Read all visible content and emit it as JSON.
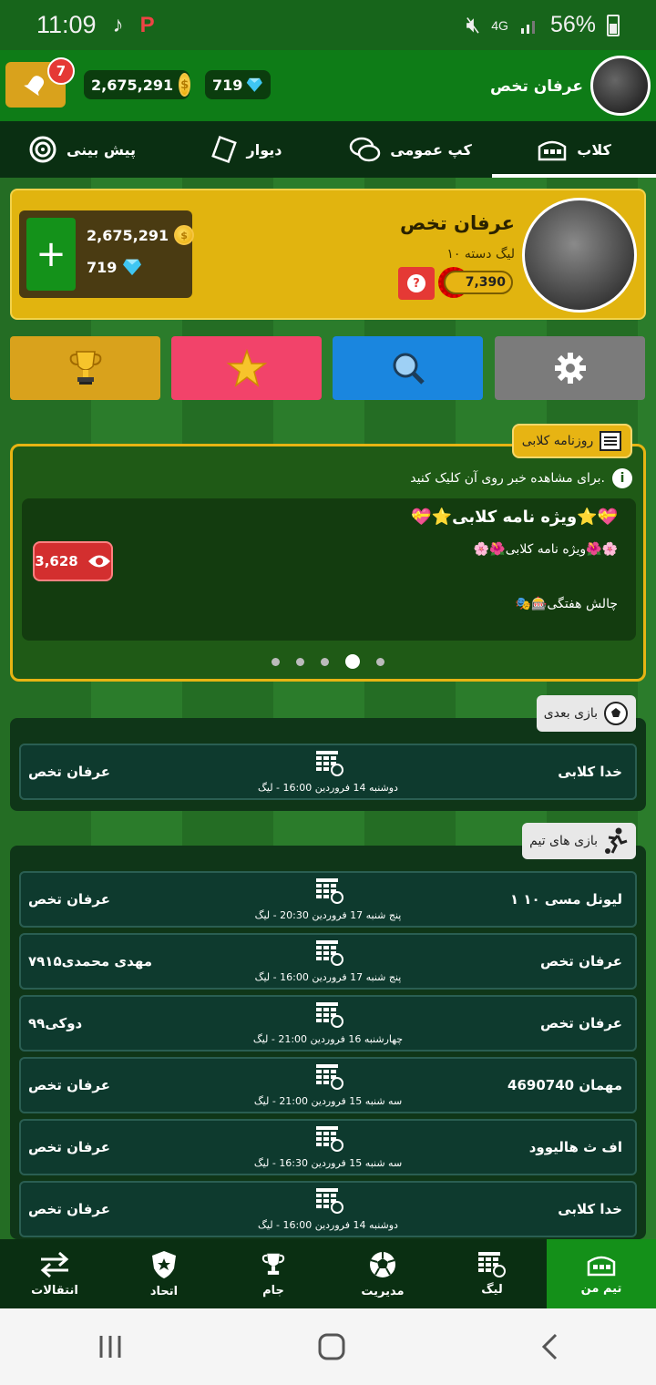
{
  "status_bar": {
    "time": "11:09",
    "battery": "56%",
    "network": "4G",
    "icons": [
      "music-note-icon",
      "app-notification-icon",
      "mute-icon",
      "signal-icon",
      "battery-icon"
    ]
  },
  "top_bar": {
    "notification_count": "7",
    "coins": "2,675,291",
    "gems": "719",
    "username": "عرفان تخص"
  },
  "tabs": [
    {
      "label": "کلاب",
      "icon": "stadium-icon",
      "active": true
    },
    {
      "label": "کپ عمومی",
      "icon": "chat-bubbles-icon",
      "active": false
    },
    {
      "label": "دیوار",
      "icon": "wall-card-icon",
      "active": false
    },
    {
      "label": "پیش بینی",
      "icon": "target-icon",
      "active": false
    }
  ],
  "profile": {
    "name": "عرفان تخص",
    "league": "لیگ دسته ۱۰",
    "xp": "7,390",
    "coins": "2,675,291",
    "gems": "719",
    "add_label": "+"
  },
  "actions": [
    {
      "name": "settings-button",
      "icon": "gear-icon",
      "color": "#7b7b7b"
    },
    {
      "name": "search-button",
      "icon": "search-icon",
      "color": "#1a86df"
    },
    {
      "name": "favorites-button",
      "icon": "star-icon",
      "color": "#f2436a"
    },
    {
      "name": "trophies-button",
      "icon": "trophy-icon",
      "color": "#d9a21c"
    }
  ],
  "news": {
    "tag": "روزنامه کلابی",
    "hint": "برای مشاهده خبر روی آن کلیک کنید.",
    "title": "💝⭐ویژه نامه کلابی⭐💝",
    "subtitle": "🌸🌺ویژه نامه کلابی🌺🌸",
    "subtitle2": "🎭🎰چالش هفتگی",
    "views": "3,628",
    "dots_count": 5,
    "active_dot": 3
  },
  "next_match": {
    "tag": "بازی بعدی",
    "match": {
      "home": "خدا کلابی",
      "away": "عرفان تخص",
      "info": "دوشنبه 14 فروردین 16:00 - لیگ"
    }
  },
  "team_matches": {
    "tag": "بازی های تیم",
    "matches": [
      {
        "home": "۱ لیونل مسی ۱۰",
        "away": "عرفان تخص",
        "info": "پنج شنبه 17 فروردین 20:30 - لیگ"
      },
      {
        "home": "عرفان تخص",
        "away": "مهدی محمدی۷۹۱۵",
        "info": "پنج شنبه 17 فروردین 16:00 - لیگ"
      },
      {
        "home": "عرفان تخص",
        "away": "دوکی۹۹",
        "info": "چهارشنبه 16 فروردین 21:00 - لیگ"
      },
      {
        "home": "مهمان 4690740",
        "away": "عرفان تخص",
        "info": "سه شنبه 15 فروردین 21:00 - لیگ"
      },
      {
        "home": "اف ث هالیوود",
        "away": "عرفان تخص",
        "info": "سه شنبه 15 فروردین 16:30 - لیگ"
      },
      {
        "home": "خدا کلابی",
        "away": "عرفان تخص",
        "info": "دوشنبه 14 فروردین 16:00 - لیگ"
      }
    ]
  },
  "bottom_nav": [
    {
      "label": "تیم من",
      "icon": "stadium-icon",
      "active": true
    },
    {
      "label": "لیگ",
      "icon": "calendar-grid-icon",
      "active": false
    },
    {
      "label": "مدیریت",
      "icon": "soccer-ball-icon",
      "active": false
    },
    {
      "label": "جام",
      "icon": "trophy-icon",
      "active": false
    },
    {
      "label": "اتحاد",
      "icon": "shield-star-icon",
      "active": false
    },
    {
      "label": "انتقالات",
      "icon": "transfer-arrows-icon",
      "active": false
    }
  ]
}
